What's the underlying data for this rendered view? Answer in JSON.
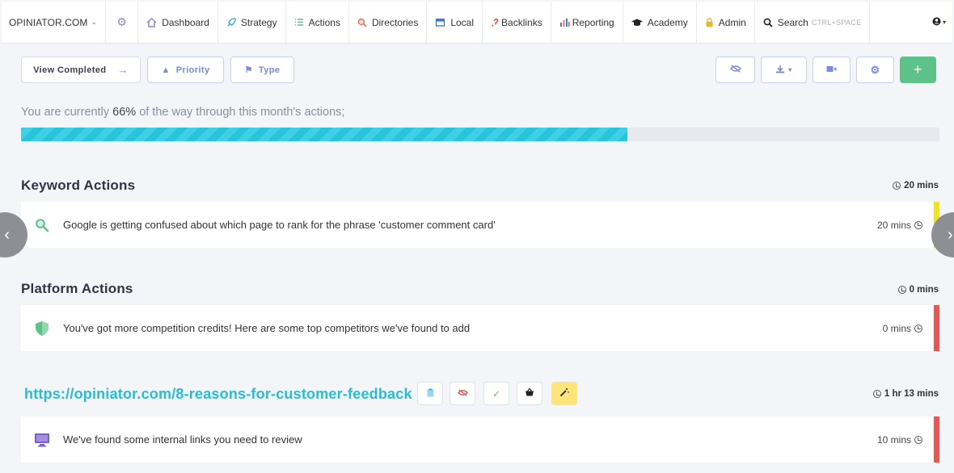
{
  "nav": {
    "brand": "OPINIATOR.COM",
    "items": [
      {
        "label": "Dashboard",
        "icon": "home-icon",
        "color": "#8a86c9"
      },
      {
        "label": "Strategy",
        "icon": "rocket-icon",
        "color": "#2bb3d6"
      },
      {
        "label": "Actions",
        "icon": "list-icon",
        "color": "#5cc28a"
      },
      {
        "label": "Directories",
        "icon": "magnifier-icon",
        "color": "#e8746a"
      },
      {
        "label": "Local",
        "icon": "store-icon",
        "color": "#3a7bd5"
      },
      {
        "label": "Backlinks",
        "icon": "link-icon",
        "color": "#e8544a"
      },
      {
        "label": "Reporting",
        "icon": "bar-chart-icon",
        "color": "#7a67c9"
      },
      {
        "label": "Academy",
        "icon": "graduation-cap-icon",
        "color": "#222222"
      },
      {
        "label": "Admin",
        "icon": "lock-icon",
        "color": "#f0b429"
      }
    ],
    "search_label": "Search",
    "search_hint": "CTRL+SPACE"
  },
  "toolbar": {
    "view_completed": "View Completed",
    "priority": "Priority",
    "type": "Type",
    "right_buttons": [
      "eye-slash-icon",
      "download-icon",
      "video-icon",
      "gear-icon",
      "plus-icon"
    ]
  },
  "progress": {
    "prefix": "You are currently",
    "percent_text": "66%",
    "suffix": "of the way through this month's actions;",
    "value": 0.66
  },
  "sections": {
    "keyword": {
      "title": "Keyword Actions",
      "total": "20 mins",
      "card_text": "Google is getting confused about which page to rank for the phrase 'customer comment card'",
      "card_time": "20 mins",
      "bar_color": "#f4e21b"
    },
    "platform": {
      "title": "Platform Actions",
      "total": "0 mins",
      "card_text": "You've got more competition credits! Here are some top competitors we've found to add",
      "card_time": "0 mins",
      "bar_color": "#ef5350"
    },
    "page": {
      "url": "https://opiniator.com/8-reasons-for-customer-feedback",
      "total": "1 hr 13 mins",
      "card_text": "We've found some internal links you need to review",
      "card_time": "10 mins",
      "bar_color": "#ef5350"
    }
  },
  "colors": {
    "accent": "#7a88e8",
    "teal": "#28bcd6",
    "green": "#5cc28a"
  }
}
